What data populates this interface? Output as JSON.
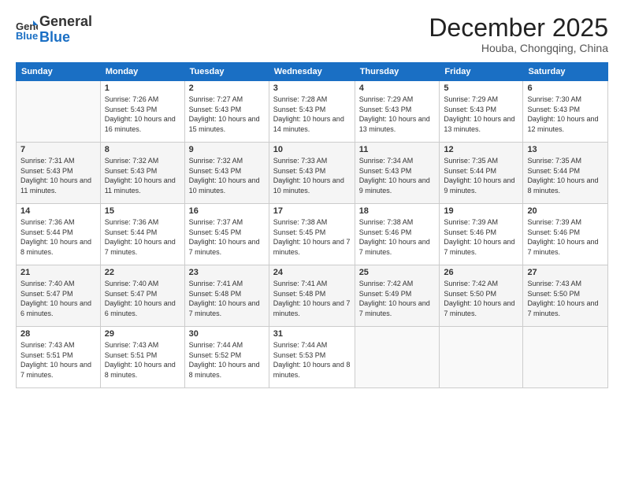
{
  "logo": {
    "general": "General",
    "blue": "Blue"
  },
  "title": "December 2025",
  "location": "Houba, Chongqing, China",
  "days_of_week": [
    "Sunday",
    "Monday",
    "Tuesday",
    "Wednesday",
    "Thursday",
    "Friday",
    "Saturday"
  ],
  "weeks": [
    [
      {
        "day": "",
        "sunrise": "",
        "sunset": "",
        "daylight": ""
      },
      {
        "day": "1",
        "sunrise": "Sunrise: 7:26 AM",
        "sunset": "Sunset: 5:43 PM",
        "daylight": "Daylight: 10 hours and 16 minutes."
      },
      {
        "day": "2",
        "sunrise": "Sunrise: 7:27 AM",
        "sunset": "Sunset: 5:43 PM",
        "daylight": "Daylight: 10 hours and 15 minutes."
      },
      {
        "day": "3",
        "sunrise": "Sunrise: 7:28 AM",
        "sunset": "Sunset: 5:43 PM",
        "daylight": "Daylight: 10 hours and 14 minutes."
      },
      {
        "day": "4",
        "sunrise": "Sunrise: 7:29 AM",
        "sunset": "Sunset: 5:43 PM",
        "daylight": "Daylight: 10 hours and 13 minutes."
      },
      {
        "day": "5",
        "sunrise": "Sunrise: 7:29 AM",
        "sunset": "Sunset: 5:43 PM",
        "daylight": "Daylight: 10 hours and 13 minutes."
      },
      {
        "day": "6",
        "sunrise": "Sunrise: 7:30 AM",
        "sunset": "Sunset: 5:43 PM",
        "daylight": "Daylight: 10 hours and 12 minutes."
      }
    ],
    [
      {
        "day": "7",
        "sunrise": "Sunrise: 7:31 AM",
        "sunset": "Sunset: 5:43 PM",
        "daylight": "Daylight: 10 hours and 11 minutes."
      },
      {
        "day": "8",
        "sunrise": "Sunrise: 7:32 AM",
        "sunset": "Sunset: 5:43 PM",
        "daylight": "Daylight: 10 hours and 11 minutes."
      },
      {
        "day": "9",
        "sunrise": "Sunrise: 7:32 AM",
        "sunset": "Sunset: 5:43 PM",
        "daylight": "Daylight: 10 hours and 10 minutes."
      },
      {
        "day": "10",
        "sunrise": "Sunrise: 7:33 AM",
        "sunset": "Sunset: 5:43 PM",
        "daylight": "Daylight: 10 hours and 10 minutes."
      },
      {
        "day": "11",
        "sunrise": "Sunrise: 7:34 AM",
        "sunset": "Sunset: 5:43 PM",
        "daylight": "Daylight: 10 hours and 9 minutes."
      },
      {
        "day": "12",
        "sunrise": "Sunrise: 7:35 AM",
        "sunset": "Sunset: 5:44 PM",
        "daylight": "Daylight: 10 hours and 9 minutes."
      },
      {
        "day": "13",
        "sunrise": "Sunrise: 7:35 AM",
        "sunset": "Sunset: 5:44 PM",
        "daylight": "Daylight: 10 hours and 8 minutes."
      }
    ],
    [
      {
        "day": "14",
        "sunrise": "Sunrise: 7:36 AM",
        "sunset": "Sunset: 5:44 PM",
        "daylight": "Daylight: 10 hours and 8 minutes."
      },
      {
        "day": "15",
        "sunrise": "Sunrise: 7:36 AM",
        "sunset": "Sunset: 5:44 PM",
        "daylight": "Daylight: 10 hours and 7 minutes."
      },
      {
        "day": "16",
        "sunrise": "Sunrise: 7:37 AM",
        "sunset": "Sunset: 5:45 PM",
        "daylight": "Daylight: 10 hours and 7 minutes."
      },
      {
        "day": "17",
        "sunrise": "Sunrise: 7:38 AM",
        "sunset": "Sunset: 5:45 PM",
        "daylight": "Daylight: 10 hours and 7 minutes."
      },
      {
        "day": "18",
        "sunrise": "Sunrise: 7:38 AM",
        "sunset": "Sunset: 5:46 PM",
        "daylight": "Daylight: 10 hours and 7 minutes."
      },
      {
        "day": "19",
        "sunrise": "Sunrise: 7:39 AM",
        "sunset": "Sunset: 5:46 PM",
        "daylight": "Daylight: 10 hours and 7 minutes."
      },
      {
        "day": "20",
        "sunrise": "Sunrise: 7:39 AM",
        "sunset": "Sunset: 5:46 PM",
        "daylight": "Daylight: 10 hours and 7 minutes."
      }
    ],
    [
      {
        "day": "21",
        "sunrise": "Sunrise: 7:40 AM",
        "sunset": "Sunset: 5:47 PM",
        "daylight": "Daylight: 10 hours and 6 minutes."
      },
      {
        "day": "22",
        "sunrise": "Sunrise: 7:40 AM",
        "sunset": "Sunset: 5:47 PM",
        "daylight": "Daylight: 10 hours and 6 minutes."
      },
      {
        "day": "23",
        "sunrise": "Sunrise: 7:41 AM",
        "sunset": "Sunset: 5:48 PM",
        "daylight": "Daylight: 10 hours and 7 minutes."
      },
      {
        "day": "24",
        "sunrise": "Sunrise: 7:41 AM",
        "sunset": "Sunset: 5:48 PM",
        "daylight": "Daylight: 10 hours and 7 minutes."
      },
      {
        "day": "25",
        "sunrise": "Sunrise: 7:42 AM",
        "sunset": "Sunset: 5:49 PM",
        "daylight": "Daylight: 10 hours and 7 minutes."
      },
      {
        "day": "26",
        "sunrise": "Sunrise: 7:42 AM",
        "sunset": "Sunset: 5:50 PM",
        "daylight": "Daylight: 10 hours and 7 minutes."
      },
      {
        "day": "27",
        "sunrise": "Sunrise: 7:43 AM",
        "sunset": "Sunset: 5:50 PM",
        "daylight": "Daylight: 10 hours and 7 minutes."
      }
    ],
    [
      {
        "day": "28",
        "sunrise": "Sunrise: 7:43 AM",
        "sunset": "Sunset: 5:51 PM",
        "daylight": "Daylight: 10 hours and 7 minutes."
      },
      {
        "day": "29",
        "sunrise": "Sunrise: 7:43 AM",
        "sunset": "Sunset: 5:51 PM",
        "daylight": "Daylight: 10 hours and 8 minutes."
      },
      {
        "day": "30",
        "sunrise": "Sunrise: 7:44 AM",
        "sunset": "Sunset: 5:52 PM",
        "daylight": "Daylight: 10 hours and 8 minutes."
      },
      {
        "day": "31",
        "sunrise": "Sunrise: 7:44 AM",
        "sunset": "Sunset: 5:53 PM",
        "daylight": "Daylight: 10 hours and 8 minutes."
      },
      {
        "day": "",
        "sunrise": "",
        "sunset": "",
        "daylight": ""
      },
      {
        "day": "",
        "sunrise": "",
        "sunset": "",
        "daylight": ""
      },
      {
        "day": "",
        "sunrise": "",
        "sunset": "",
        "daylight": ""
      }
    ]
  ]
}
